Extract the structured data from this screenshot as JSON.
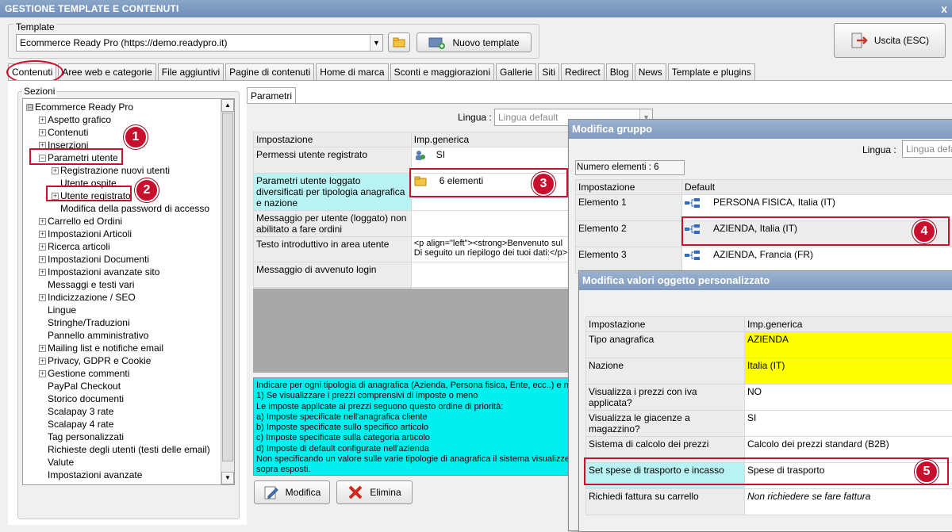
{
  "window": {
    "title": "GESTIONE TEMPLATE E CONTENUTI",
    "close": "x"
  },
  "template": {
    "group_label": "Template",
    "selected": "Ecommerce Ready Pro (https://demo.readypro.it)",
    "new_button": "Nuovo template",
    "exit_button": "Uscita (ESC)"
  },
  "tabs": [
    "Contenuti",
    "Aree web e categorie",
    "File aggiuntivi",
    "Pagine di contenuti",
    "Home di marca",
    "Sconti e maggiorazioni",
    "Gallerie",
    "Siti",
    "Redirect",
    "Blog",
    "News",
    "Template e plugins"
  ],
  "sections": {
    "label": "Sezioni",
    "tree": [
      {
        "text": "Ecommerce Ready Pro",
        "pm": "⊟",
        "lvl": 0
      },
      {
        "text": "Aspetto grafico",
        "pm": "+",
        "lvl": 1
      },
      {
        "text": "Contenuti",
        "pm": "+",
        "lvl": 1
      },
      {
        "text": "Inserzioni",
        "pm": "+",
        "lvl": 1
      },
      {
        "text": "Parametri utente",
        "pm": "−",
        "lvl": 1
      },
      {
        "text": "Registrazione nuovi utenti",
        "pm": "+",
        "lvl": 2
      },
      {
        "text": "Utente ospite",
        "pm": "",
        "lvl": 2
      },
      {
        "text": "Utente registrato",
        "pm": "+",
        "lvl": 2
      },
      {
        "text": "Modifica della password di accesso",
        "pm": "",
        "lvl": 2
      },
      {
        "text": "Carrello ed Ordini",
        "pm": "+",
        "lvl": 1
      },
      {
        "text": "Impostazioni Articoli",
        "pm": "+",
        "lvl": 1
      },
      {
        "text": "Ricerca articoli",
        "pm": "+",
        "lvl": 1
      },
      {
        "text": "Impostazioni Documenti",
        "pm": "+",
        "lvl": 1
      },
      {
        "text": "Impostazioni avanzate sito",
        "pm": "+",
        "lvl": 1
      },
      {
        "text": "Messaggi e testi vari",
        "pm": "",
        "lvl": 1
      },
      {
        "text": "Indicizzazione / SEO",
        "pm": "+",
        "lvl": 1
      },
      {
        "text": "Lingue",
        "pm": "",
        "lvl": 1
      },
      {
        "text": "Stringhe/Traduzioni",
        "pm": "",
        "lvl": 1
      },
      {
        "text": "Pannello amministrativo",
        "pm": "",
        "lvl": 1
      },
      {
        "text": "Mailing list e notifiche email",
        "pm": "+",
        "lvl": 1
      },
      {
        "text": "Privacy, GDPR e Cookie",
        "pm": "+",
        "lvl": 1
      },
      {
        "text": "Gestione commenti",
        "pm": "+",
        "lvl": 1
      },
      {
        "text": "PayPal Checkout",
        "pm": "",
        "lvl": 1
      },
      {
        "text": "Storico documenti",
        "pm": "",
        "lvl": 1
      },
      {
        "text": "Scalapay 3 rate",
        "pm": "",
        "lvl": 1
      },
      {
        "text": "Scalapay 4 rate",
        "pm": "",
        "lvl": 1
      },
      {
        "text": "Tag personalizzati",
        "pm": "",
        "lvl": 1
      },
      {
        "text": "Richieste degli utenti (testi delle email)",
        "pm": "",
        "lvl": 1
      },
      {
        "text": "Valute",
        "pm": "",
        "lvl": 1
      },
      {
        "text": "Impostazioni avanzate",
        "pm": "",
        "lvl": 1
      }
    ]
  },
  "params": {
    "tab": "Parametri",
    "lingua_label": "Lingua :",
    "lingua_placeholder": "Lingua default",
    "col1": "Impostazione",
    "col2": "Imp.generica",
    "rows": [
      {
        "k": "Permessi utente registrato",
        "v": "SI"
      },
      {
        "k": "Parametri utente loggato diversificati per tipologia anagrafica e nazione",
        "v": "6 elementi"
      },
      {
        "k": "Messaggio per utente (loggato) non abilitato a fare ordini",
        "v": ""
      },
      {
        "k": "Testo introduttivo in area utente",
        "v": "<p align=\"left\"><strong>Benvenuto sul\nDi seguito un riepilogo dei tuoi dati:</p>"
      },
      {
        "k": "Messaggio di avvenuto login",
        "v": ""
      }
    ],
    "help": "Indicare per ogni tipologia di anagrafica (Azienda, Persona fisica, Ente, ecc..) e na\n1) Se visualizzare i prezzi comprensivi di imposte o meno\nLe imposte applicate ai prezzi seguono questo ordine di priorità:\na) Imposte specificate nell'anagrafica cliente\nb) Imposte specificate sullo specifico articolo\nc) Imposte specificate sulla categoria articolo\nd) Imposte di default configurate nell'azienda\nNon specificando un valore sulle varie tipologie di anagrafica il sistema visualizzera'\nsopra esposti.",
    "modify": "Modifica",
    "delete": "Elimina"
  },
  "gruppo": {
    "title": "Modifica gruppo",
    "lingua_label": "Lingua :",
    "lingua_placeholder": "Lingua defau",
    "count": "Numero elementi : 6",
    "col1": "Impostazione",
    "col2": "Default",
    "rows": [
      {
        "k": "Elemento 1",
        "v": "PERSONA FISICA, Italia (IT)"
      },
      {
        "k": "Elemento 2",
        "v": "AZIENDA, Italia (IT)"
      },
      {
        "k": "Elemento 3",
        "v": "AZIENDA, Francia (FR)"
      }
    ]
  },
  "oggetto": {
    "title": "Modifica valori oggetto personalizzato",
    "col1": "Impostazione",
    "col2": "Imp.generica",
    "rows": [
      {
        "k": "Tipo anagrafica",
        "v": "AZIENDA"
      },
      {
        "k": "Nazione",
        "v": "Italia (IT)"
      },
      {
        "k": "Visualizza i prezzi con iva applicata?",
        "v": "NO"
      },
      {
        "k": "Visualizza le giacenze a magazzino?",
        "v": "SI"
      },
      {
        "k": "Sistema di calcolo dei prezzi",
        "v": "Calcolo dei prezzi standard (B2B)"
      },
      {
        "k": "Set spese di trasporto e incasso",
        "v": "Spese di trasporto"
      },
      {
        "k": "Richiedi fattura su carrello",
        "v": "Non richiedere se fare fattura"
      }
    ]
  },
  "markers": [
    "1",
    "2",
    "3",
    "4",
    "5"
  ],
  "colors": {
    "accent_red": "#c8102e",
    "highlight_yellow": "#ffff00",
    "highlight_cyan": "#b8f2f2"
  }
}
